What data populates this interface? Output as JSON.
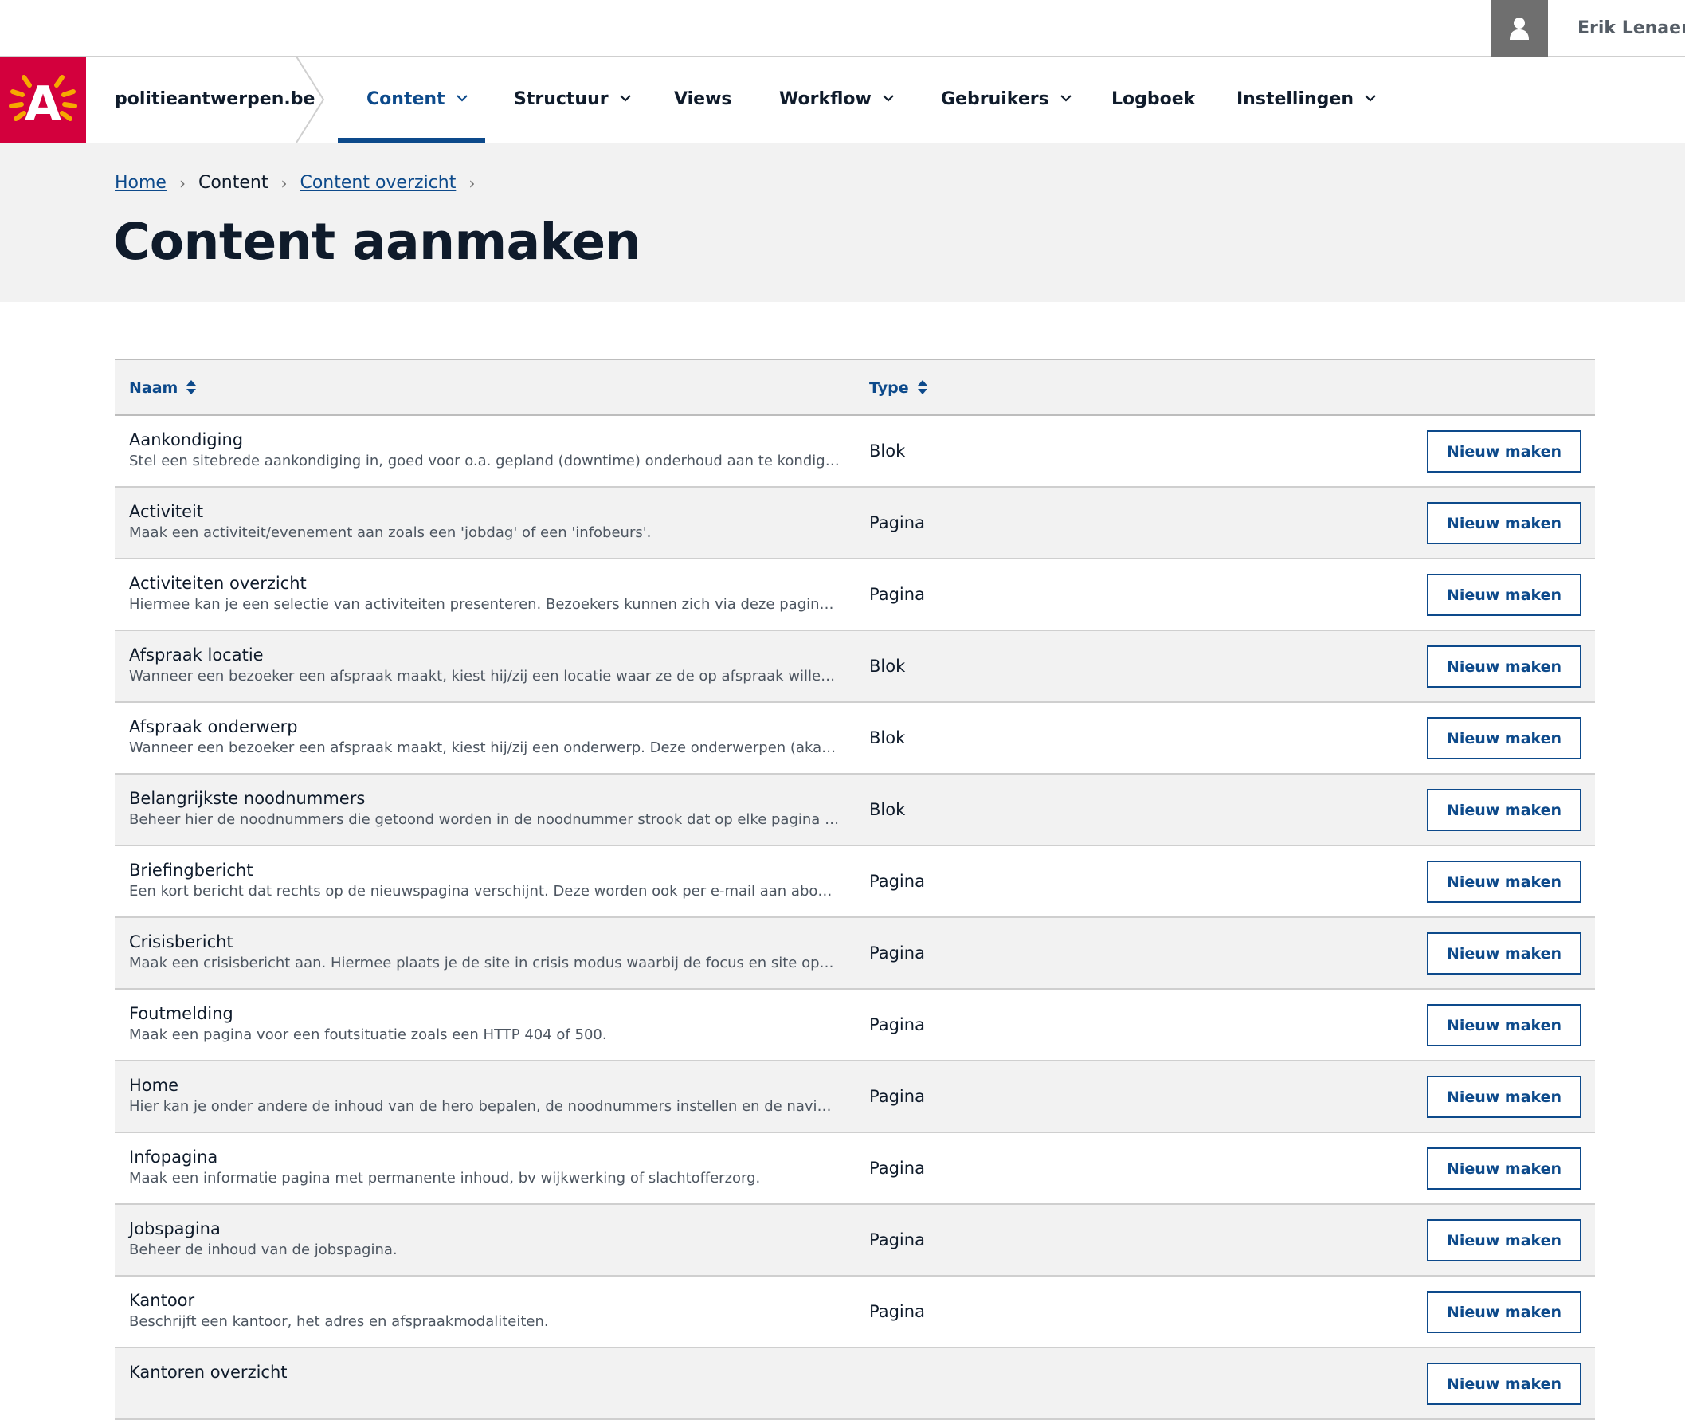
{
  "user": {
    "name": "Erik Lenaerts",
    "icon": "user-icon"
  },
  "site": {
    "name": "politieantwerpen.be",
    "logo_letter": "A",
    "logo_color": "#d3003d"
  },
  "nav": {
    "items": [
      {
        "label": "Content",
        "dropdown": true,
        "active": true
      },
      {
        "label": "Structuur",
        "dropdown": true
      },
      {
        "label": "Views",
        "dropdown": false
      },
      {
        "label": "Workflow",
        "dropdown": true
      },
      {
        "label": "Gebruikers",
        "dropdown": true
      },
      {
        "label": "Logboek",
        "dropdown": false
      },
      {
        "label": "Instellingen",
        "dropdown": true
      }
    ]
  },
  "breadcrumb": {
    "home": "Home",
    "content": "Content",
    "overview": "Content overzicht"
  },
  "page": {
    "title": "Content aanmaken"
  },
  "table": {
    "col_name": "Naam",
    "col_type": "Type",
    "button_label": "Nieuw maken",
    "rows": [
      {
        "name": "Aankondiging",
        "desc": "Stel een sitebrede aankondiging in, goed voor o.a. gepland (downtime) onderhoud aan te kondigen.",
        "type": "Blok"
      },
      {
        "name": "Activiteit",
        "desc": "Maak een activiteit/evenement aan zoals een 'jobdag' of een 'infobeurs'.",
        "type": "Pagina"
      },
      {
        "name": "Activiteiten overzicht",
        "desc": "Hiermee kan je een selectie van activiteiten presenteren. Bezoekers kunnen zich via deze pagina insc…",
        "type": "Pagina"
      },
      {
        "name": "Afspraak locatie",
        "desc": "Wanneer een bezoeker een afspraak maakt, kiest hij/zij een locatie waar ze de op afspraak willen ko…",
        "type": "Blok"
      },
      {
        "name": "Afspraak onderwerp",
        "desc": "Wanneer een bezoeker een afspraak maakt, kiest hij/zij een onderwerp. Deze onderwerpen (aka prod…",
        "type": "Blok"
      },
      {
        "name": "Belangrijkste noodnummers",
        "desc": "Beheer hier de noodnummers die getoond worden in de noodnummer strook dat op elke pagina bov…",
        "type": "Blok"
      },
      {
        "name": "Briefingbericht",
        "desc": "Een kort bericht dat rechts op de nieuwspagina verschijnt. Deze worden ook per e-mail aan abonnees…",
        "type": "Pagina"
      },
      {
        "name": "Crisisbericht",
        "desc": "Maak een crisisbericht aan. Hiermee plaats je de site in crisis modus waarbij de focus en site opmaak…",
        "type": "Pagina"
      },
      {
        "name": "Foutmelding",
        "desc": "Maak een pagina voor een foutsituatie zoals een HTTP 404 of 500.",
        "type": "Pagina"
      },
      {
        "name": "Home",
        "desc": "Hier kan je onder andere de inhoud van de hero bepalen, de noodnummers instellen en de navigatie…",
        "type": "Pagina"
      },
      {
        "name": "Infopagina",
        "desc": "Maak een informatie pagina met permanente inhoud, bv wijkwerking of slachtofferzorg.",
        "type": "Pagina"
      },
      {
        "name": "Jobspagina",
        "desc": "Beheer de inhoud van de jobspagina.",
        "type": "Pagina"
      },
      {
        "name": "Kantoor",
        "desc": "Beschrijft een kantoor, het adres en afspraakmodaliteiten.",
        "type": "Pagina"
      },
      {
        "name": "Kantoren overzicht",
        "desc": "",
        "type": ""
      }
    ]
  }
}
